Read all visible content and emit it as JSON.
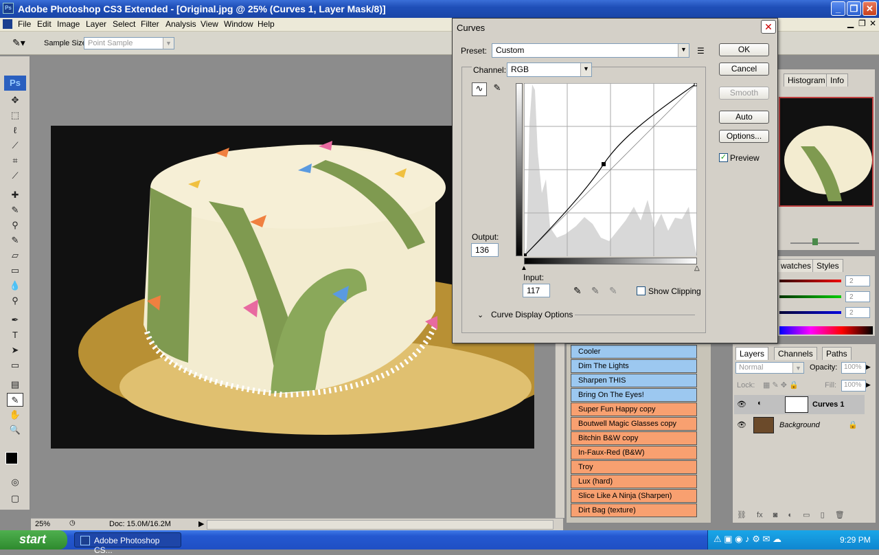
{
  "window": {
    "title": "Adobe Photoshop CS3 Extended - [Original.jpg @ 25% (Curves 1, Layer Mask/8)]",
    "icon": "Ps"
  },
  "menu": [
    "File",
    "Edit",
    "Image",
    "Layer",
    "Select",
    "Filter",
    "Analysis",
    "View",
    "Window",
    "Help"
  ],
  "options_bar": {
    "sample_size_label": "Sample Size:",
    "sample_size_value": "Point Sample"
  },
  "status_bar": {
    "zoom": "25%",
    "doc": "Doc: 15.0M/16.2M"
  },
  "curves": {
    "title": "Curves",
    "preset_label": "Preset:",
    "preset_value": "Custom",
    "channel_label": "Channel:",
    "channel_value": "RGB",
    "output_label": "Output:",
    "output_value": "136",
    "input_label": "Input:",
    "input_value": "117",
    "show_clipping": "Show Clipping",
    "curve_display_options": "Curve Display Options",
    "buttons": {
      "ok": "OK",
      "cancel": "Cancel",
      "smooth": "Smooth",
      "auto": "Auto",
      "options": "Options..."
    },
    "preview_label": "Preview",
    "preview_checked": true
  },
  "navigator_tabs": [
    "Histogram",
    "Info"
  ],
  "swatches_tabs": [
    "watches",
    "Styles"
  ],
  "color_values": [
    "2",
    "2",
    "2"
  ],
  "actions": [
    {
      "label": "Cooler",
      "color": "#9cc8f0"
    },
    {
      "label": "Dim The Lights",
      "color": "#9cc8f0"
    },
    {
      "label": "Sharpen THIS",
      "color": "#9cc8f0"
    },
    {
      "label": "Bring On The Eyes!",
      "color": "#9cc8f0"
    },
    {
      "label": "Super Fun Happy copy",
      "color": "#f8a070"
    },
    {
      "label": "Boutwell Magic Glasses copy",
      "color": "#f8a070"
    },
    {
      "label": "Bitchin B&W copy",
      "color": "#f8a070"
    },
    {
      "label": "In-Faux-Red (B&W)",
      "color": "#f8a070"
    },
    {
      "label": "Troy",
      "color": "#f8a070"
    },
    {
      "label": "Lux (hard)",
      "color": "#f8a070"
    },
    {
      "label": "Slice Like A Ninja (Sharpen)",
      "color": "#f8a070"
    },
    {
      "label": "Dirt Bag (texture)",
      "color": "#f8a070"
    }
  ],
  "layers": {
    "tabs": [
      "Layers",
      "Channels",
      "Paths"
    ],
    "blend_mode": "Normal",
    "opacity_label": "Opacity:",
    "opacity_value": "100%",
    "lock_label": "Lock:",
    "fill_label": "Fill:",
    "fill_value": "100%",
    "items": [
      {
        "name": "Curves 1"
      },
      {
        "name": "Background"
      }
    ]
  },
  "taskbar": {
    "start": "start",
    "app_button": "Adobe Photoshop CS...",
    "clock": "9:29 PM"
  }
}
